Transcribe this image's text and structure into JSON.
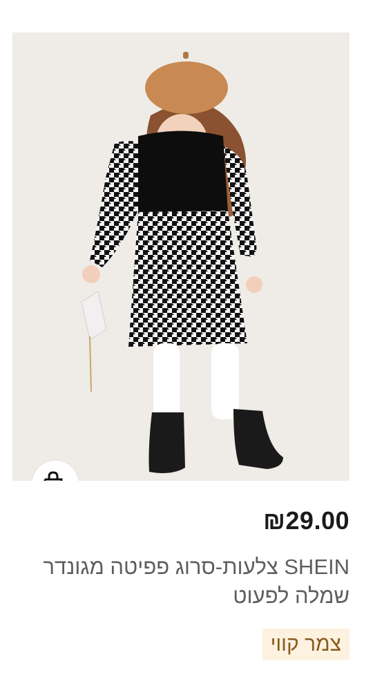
{
  "product": {
    "image_alt": "Girl in houndstooth dress with tan beret",
    "price": "₪29.00",
    "title": "SHEIN צלעות-סרוג פפיטה מגונדר שמלה לפעוט",
    "tag": "צמר קווי"
  },
  "icons": {
    "add_to_cart": "shopping-bag-plus-icon"
  },
  "colors": {
    "tag_bg": "#fdf2e0",
    "tag_text": "#8a5a1e",
    "price": "#1a1a1a",
    "title": "#5e5e5e"
  }
}
